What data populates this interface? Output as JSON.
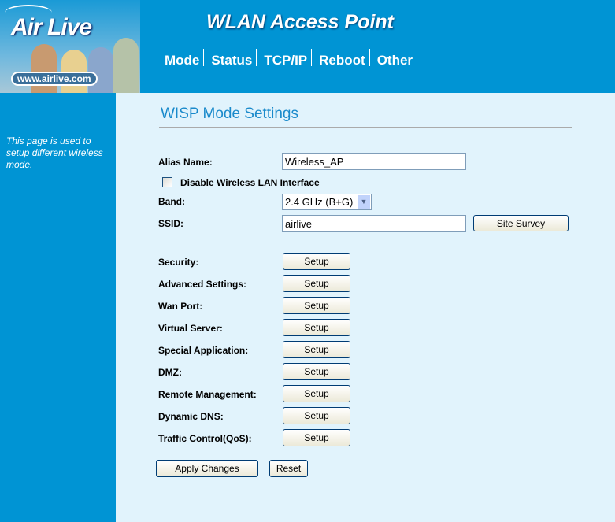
{
  "header": {
    "logo_text": "Air Live",
    "logo_url": "www.airlive.com",
    "title": "WLAN Access Point",
    "nav": [
      "Mode",
      "Status",
      "TCP/IP",
      "Reboot",
      "Other"
    ]
  },
  "sidebar": {
    "description": "This page is used to setup different wireless mode."
  },
  "main": {
    "title": "WISP Mode Settings",
    "alias_label": "Alias Name:",
    "alias_value": "Wireless_AP",
    "disable_label": "Disable Wireless LAN Interface",
    "disable_checked": false,
    "band_label": "Band:",
    "band_value": "2.4 GHz (B+G)",
    "ssid_label": "SSID:",
    "ssid_value": "airlive",
    "site_survey": "Site Survey",
    "setup_label": "Setup",
    "settings": [
      "Security:",
      "Advanced Settings:",
      "Wan Port:",
      "Virtual Server:",
      "Special Application:",
      "DMZ:",
      "Remote Management:",
      "Dynamic DNS:",
      "Traffic Control(QoS):"
    ],
    "apply": "Apply Changes",
    "reset": "Reset"
  }
}
